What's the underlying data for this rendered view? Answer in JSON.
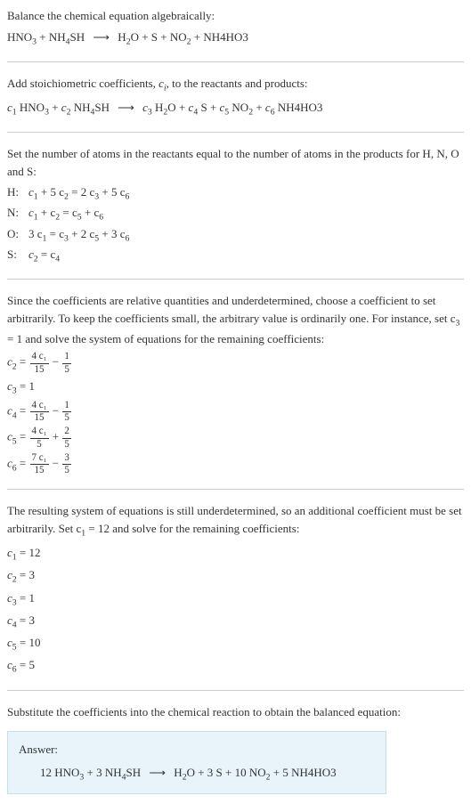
{
  "section1": {
    "title": "Balance the chemical equation algebraically:",
    "equation_parts": {
      "left1": "HNO",
      "left1_sub": "3",
      "plus1": " + NH",
      "plus1_sub": "4",
      "left2": "SH ",
      "arrow": "⟶",
      "right1": " H",
      "right1_sub": "2",
      "right2": "O + S + NO",
      "right2_sub": "2",
      "right3": " + NH4HO3"
    }
  },
  "section2": {
    "title_a": "Add stoichiometric coefficients, ",
    "title_i": "c",
    "title_isub": "i",
    "title_b": ", to the reactants and products:",
    "eq_parts": {
      "c1": "c",
      "c1s": "1",
      "t1": " HNO",
      "t1s": "3",
      "p1": " + ",
      "c2": "c",
      "c2s": "2",
      "t2": " NH",
      "t2s": "4",
      "t2b": "SH ",
      "arrow": "⟶",
      "c3": " c",
      "c3s": "3",
      "t3": " H",
      "t3s": "2",
      "t3b": "O + ",
      "c4": "c",
      "c4s": "4",
      "t4": " S + ",
      "c5": "c",
      "c5s": "5",
      "t5": " NO",
      "t5s": "2",
      "p5": " + ",
      "c6": "c",
      "c6s": "6",
      "t6": " NH4HO3"
    }
  },
  "section3": {
    "title": "Set the number of atoms in the reactants equal to the number of atoms in the products for H, N, O and S:",
    "rows": [
      {
        "label": "H:",
        "lhs_a": "c",
        "lhs_as": "1",
        "lhs_b": " + 5 c",
        "lhs_bs": "2",
        "eq": " = 2 c",
        "rhs_as": "3",
        "rhs_b": " + 5 c",
        "rhs_bs": "6"
      },
      {
        "label": "N:",
        "lhs_a": "c",
        "lhs_as": "1",
        "lhs_b": " + c",
        "lhs_bs": "2",
        "eq": " = c",
        "rhs_as": "5",
        "rhs_b": " + c",
        "rhs_bs": "6"
      },
      {
        "label": "O:",
        "lhs_a": "3 c",
        "lhs_as": "1",
        "lhs_b": "",
        "lhs_bs": "",
        "eq": " = c",
        "rhs_as": "3",
        "rhs_b": " + 2 c",
        "rhs_bs": "5",
        "rhs_c": " + 3 c",
        "rhs_cs": "6"
      },
      {
        "label": "S:",
        "lhs_a": "c",
        "lhs_as": "2",
        "lhs_b": "",
        "lhs_bs": "",
        "eq": " = c",
        "rhs_as": "4",
        "rhs_b": "",
        "rhs_bs": ""
      }
    ]
  },
  "section4": {
    "title_a": "Since the coefficients are relative quantities and underdetermined, choose a coefficient to set arbitrarily. To keep the coefficients small, the arbitrary value is ordinarily one. For instance, set c",
    "title_sub": "3",
    "title_b": " = 1 and solve the system of equations for the remaining coefficients:",
    "coeffs": {
      "c2": {
        "lhs": "c",
        "lhs_s": "2",
        "eq": " = ",
        "f1n": "4 c₁",
        "f1d": "15",
        "minus": " − ",
        "f2n": "1",
        "f2d": "5"
      },
      "c3": {
        "lhs": "c",
        "lhs_s": "3",
        "eq": " = 1"
      },
      "c4": {
        "lhs": "c",
        "lhs_s": "4",
        "eq": " = ",
        "f1n": "4 c₁",
        "f1d": "15",
        "minus": " − ",
        "f2n": "1",
        "f2d": "5"
      },
      "c5": {
        "lhs": "c",
        "lhs_s": "5",
        "eq": " = ",
        "f1n": "4 c₁",
        "f1d": "5",
        "minus": " + ",
        "f2n": "2",
        "f2d": "5"
      },
      "c6": {
        "lhs": "c",
        "lhs_s": "6",
        "eq": " = ",
        "f1n": "7 c₁",
        "f1d": "15",
        "minus": " − ",
        "f2n": "3",
        "f2d": "5"
      }
    }
  },
  "section5": {
    "title_a": "The resulting system of equations is still underdetermined, so an additional coefficient must be set arbitrarily. Set c",
    "title_sub": "1",
    "title_b": " = 12 and solve for the remaining coefficients:",
    "coeffs": [
      {
        "c": "c",
        "s": "1",
        "v": " = 12"
      },
      {
        "c": "c",
        "s": "2",
        "v": " = 3"
      },
      {
        "c": "c",
        "s": "3",
        "v": " = 1"
      },
      {
        "c": "c",
        "s": "4",
        "v": " = 3"
      },
      {
        "c": "c",
        "s": "5",
        "v": " = 10"
      },
      {
        "c": "c",
        "s": "6",
        "v": " = 5"
      }
    ]
  },
  "section6": {
    "title": "Substitute the coefficients into the chemical reaction to obtain the balanced equation:",
    "answer_label": "Answer:",
    "answer_parts": {
      "t1": "12 HNO",
      "t1s": "3",
      "t2": " + 3 NH",
      "t2s": "4",
      "t3": "SH ",
      "arrow": "⟶",
      "t4": " H",
      "t4s": "2",
      "t5": "O + 3 S + 10 NO",
      "t5s": "2",
      "t6": " + 5 NH4HO3"
    }
  }
}
